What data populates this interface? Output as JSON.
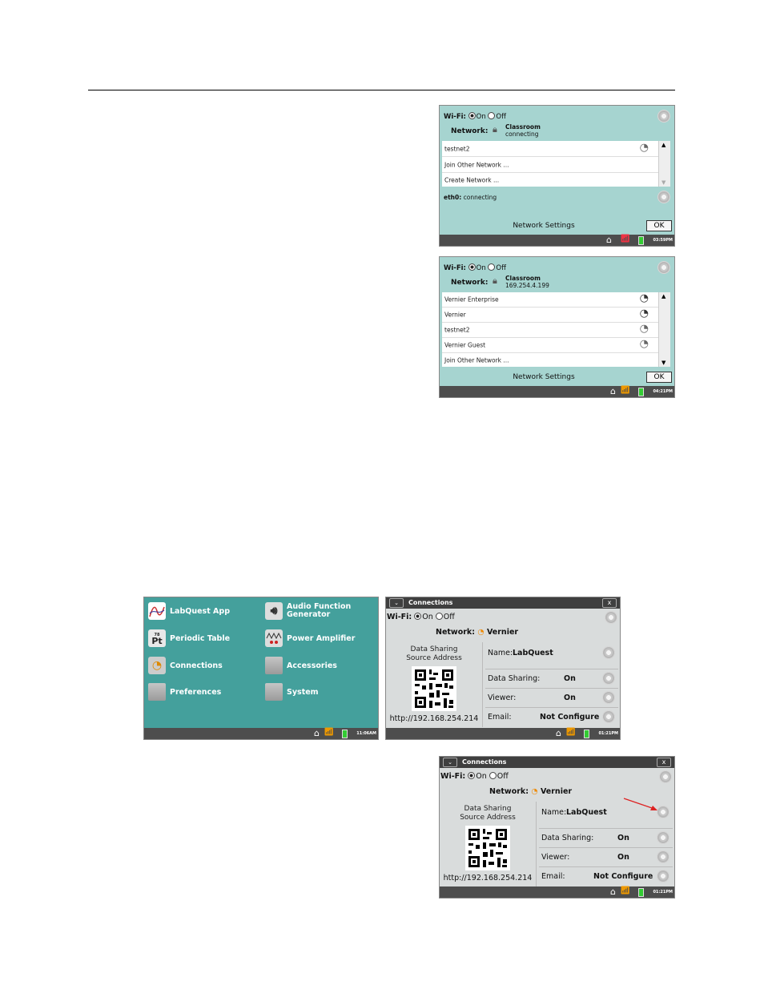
{
  "s1": {
    "wifi_label": "Wi-Fi:",
    "on": "On",
    "off": "Off",
    "network_label": "Network:",
    "network_name": "Classroom",
    "network_status": "connecting",
    "rows": [
      "testnet2",
      "Join Other Network ...",
      "Create Network ..."
    ],
    "eth_label": "eth0:",
    "eth_status": "connecting",
    "footer": "Network Settings",
    "ok": "OK",
    "clock": "03:59PM"
  },
  "s2": {
    "wifi_label": "Wi-Fi:",
    "on": "On",
    "off": "Off",
    "network_label": "Network:",
    "network_name": "Classroom",
    "network_status": "169.254.4.199",
    "rows": [
      "Vernier Enterprise",
      "Vernier",
      "testnet2",
      "Vernier Guest",
      "Join Other Network ..."
    ],
    "footer": "Network Settings",
    "ok": "OK",
    "clock": "04:21PM"
  },
  "home": {
    "items": [
      "LabQuest App",
      "Audio Function Generator",
      "Periodic Table",
      "Power Amplifier",
      "Connections",
      "Accessories",
      "Preferences",
      "System"
    ],
    "pt_number": "78",
    "pt_symbol": "Pt",
    "clock": "11:06AM"
  },
  "conn": {
    "title": "Connections",
    "close": "x",
    "wifi_label": "Wi-Fi:",
    "on": "On",
    "off": "Off",
    "network_label": "Network:",
    "network_name": "Vernier",
    "ds_line1": "Data Sharing",
    "ds_line2": "Source Address",
    "url": "http://192.168.254.214",
    "name_label": "Name:",
    "name_value": "LabQuest",
    "data_sharing_label": "Data Sharing:",
    "data_sharing_value": "On",
    "viewer_label": "Viewer:",
    "viewer_value": "On",
    "email_label": "Email:",
    "email_value": "Not Configure",
    "clock": "01:21PM"
  },
  "colors": {
    "teal": "#a6d4d0",
    "home_bg": "#44a09c",
    "taskbar": "#4d4d4d",
    "conn_bg": "#d9dcdc"
  }
}
